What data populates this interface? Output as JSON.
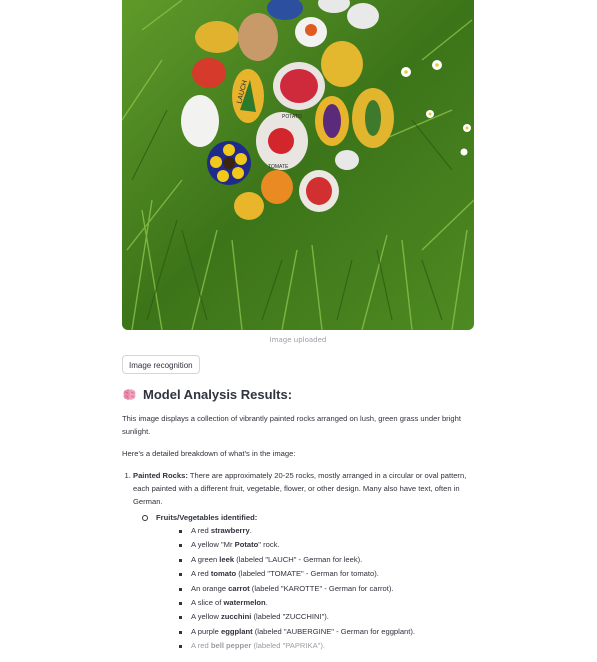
{
  "image": {
    "caption": "Image uploaded",
    "rock_texts": [
      "LAUCH",
      "POTATO",
      "TOMATE"
    ]
  },
  "button": {
    "label": "Image recognition"
  },
  "results": {
    "heading": "Model Analysis Results:",
    "intro": "This image displays a collection of vibrantly painted rocks arranged on lush, green grass under bright sunlight.",
    "breakdown_intro": "Here's a detailed breakdown of what's in the image:",
    "point1": {
      "title": "Painted Rocks:",
      "text": " There are approximately 20-25 rocks, mostly arranged in a circular or oval pattern, each painted with a different fruit, vegetable, flower, or other design. Many also have text, often in German."
    },
    "subheading": "Fruits/Vegetables identified:",
    "items": [
      {
        "pre": "A red ",
        "bold": "strawberry",
        "post": "."
      },
      {
        "pre": "A yellow \"Mr ",
        "bold": "Potato",
        "post": "\" rock."
      },
      {
        "pre": "A green ",
        "bold": "leek",
        "post": " (labeled \"LAUCH\" - German for leek)."
      },
      {
        "pre": "A red ",
        "bold": "tomato",
        "post": " (labeled \"TOMATE\" - German for tomato)."
      },
      {
        "pre": "An orange ",
        "bold": "carrot",
        "post": " (labeled \"KAROTTE\" - German for carrot)."
      },
      {
        "pre": "A slice of ",
        "bold": "watermelon",
        "post": "."
      },
      {
        "pre": "A yellow ",
        "bold": "zucchini",
        "post": " (labeled \"ZUCCHINI\")."
      },
      {
        "pre": "A purple ",
        "bold": "eggplant",
        "post": " (labeled \"AUBERGINE\" - German for eggplant)."
      },
      {
        "pre": "A red ",
        "bold": "bell pepper",
        "post": " (labeled \"PAPRIKA\")."
      }
    ]
  },
  "colors": {
    "grass": "#3f7a1c",
    "accent_text": "#31333f",
    "muted": "#9a9ca5"
  }
}
